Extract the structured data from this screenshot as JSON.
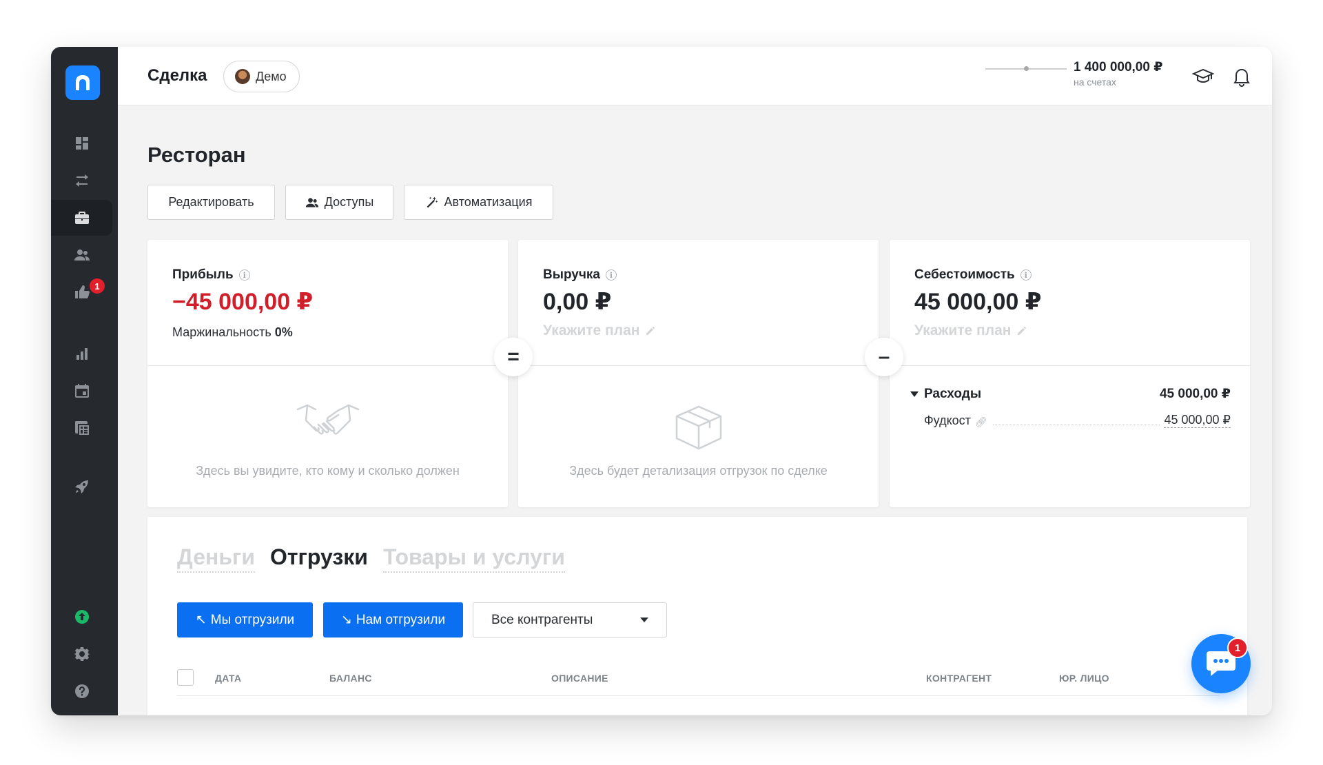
{
  "header": {
    "title": "Сделка",
    "demo_label": "Демо",
    "balance_amount": "1 400 000,00 ₽",
    "balance_caption": "на счетах"
  },
  "sidebar": {
    "items": [
      {
        "icon": "dashboard-icon"
      },
      {
        "icon": "transfer-icon"
      },
      {
        "icon": "briefcase-icon",
        "active": true
      },
      {
        "icon": "users-icon"
      },
      {
        "icon": "thumbs-up-icon",
        "badge": "1"
      },
      {
        "icon": "bar-chart-icon"
      },
      {
        "icon": "calendar-icon"
      },
      {
        "icon": "calculator-icon"
      },
      {
        "icon": "rocket-icon"
      },
      {
        "icon": "arrow-up-circle-icon"
      },
      {
        "icon": "gear-icon"
      },
      {
        "icon": "help-icon"
      }
    ]
  },
  "page": {
    "title": "Ресторан",
    "buttons": {
      "edit": "Редактировать",
      "access": "Доступы",
      "automation": "Автоматизация"
    }
  },
  "cards": {
    "profit": {
      "label": "Прибыль",
      "value": "−45 000,00 ₽",
      "margin_label": "Маржинальность",
      "margin_value": "0%",
      "empty_text": "Здесь вы увидите, кто кому и сколько должен"
    },
    "revenue": {
      "label": "Выручка",
      "value": "0,00 ₽",
      "plan_hint": "Укажите план",
      "empty_text": "Здесь будет детализация отгрузок по сделке"
    },
    "cost": {
      "label": "Себестоимость",
      "value": "45 000,00 ₽",
      "plan_hint": "Укажите план",
      "expenses_label": "Расходы",
      "expenses_total": "45 000,00 ₽",
      "items": [
        {
          "name": "Фудкост",
          "amount": "45 000,00 ₽"
        }
      ]
    },
    "operators": {
      "equals": "=",
      "minus": "–"
    }
  },
  "bottom": {
    "tabs": [
      "Деньги",
      "Отгрузки",
      "Товары и услуги"
    ],
    "active_tab": "Отгрузки",
    "btn_we_shipped": "Мы отгрузили",
    "btn_shipped_to_us": "Нам отгрузили",
    "counterparty_select": "Все контрагенты",
    "table_headers": [
      "ДАТА",
      "БАЛАНС",
      "ОПИСАНИЕ",
      "КОНТРАГЕНТ",
      "ЮР. ЛИЦО"
    ]
  },
  "chat": {
    "badge": "1"
  },
  "colors": {
    "accent": "#1a83ff",
    "button_blue": "#0a6ff0",
    "negative": "#d01f2a",
    "sidebar": "#262a2f",
    "online": "#1bb96a"
  }
}
